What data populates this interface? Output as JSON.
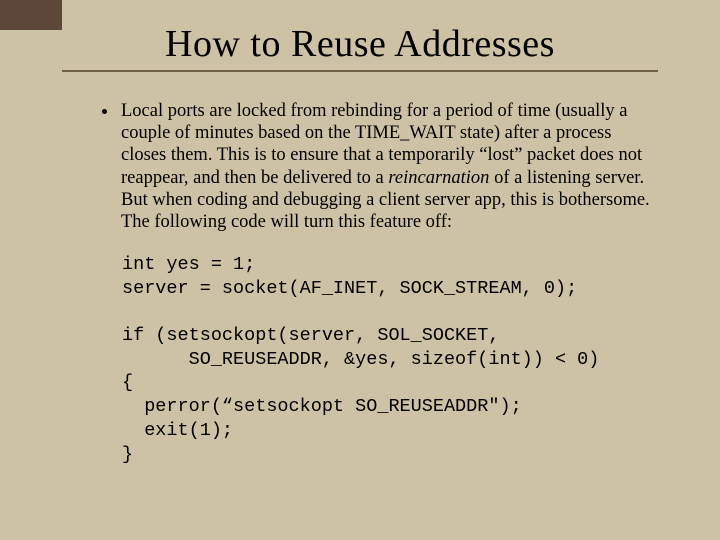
{
  "title": "How to Reuse Addresses",
  "bullet": {
    "pre": "Local ports are locked from rebinding for a period of time (usually a couple of minutes based on the TIME_WAIT state) after a process closes them.  This is to ensure that a temporarily “lost” packet does not reappear, and then be delivered to a ",
    "em": "reincarnation",
    "post": " of a listening server.  But when coding and debugging a client server app, this is bothersome.  The following code will turn this feature off:"
  },
  "code": "int yes = 1;\nserver = socket(AF_INET, SOCK_STREAM, 0);\n\nif (setsockopt(server, SOL_SOCKET,\n      SO_REUSEADDR, &yes, sizeof(int)) < 0)\n{\n  perror(“setsockopt SO_REUSEADDR\");\n  exit(1);\n}"
}
